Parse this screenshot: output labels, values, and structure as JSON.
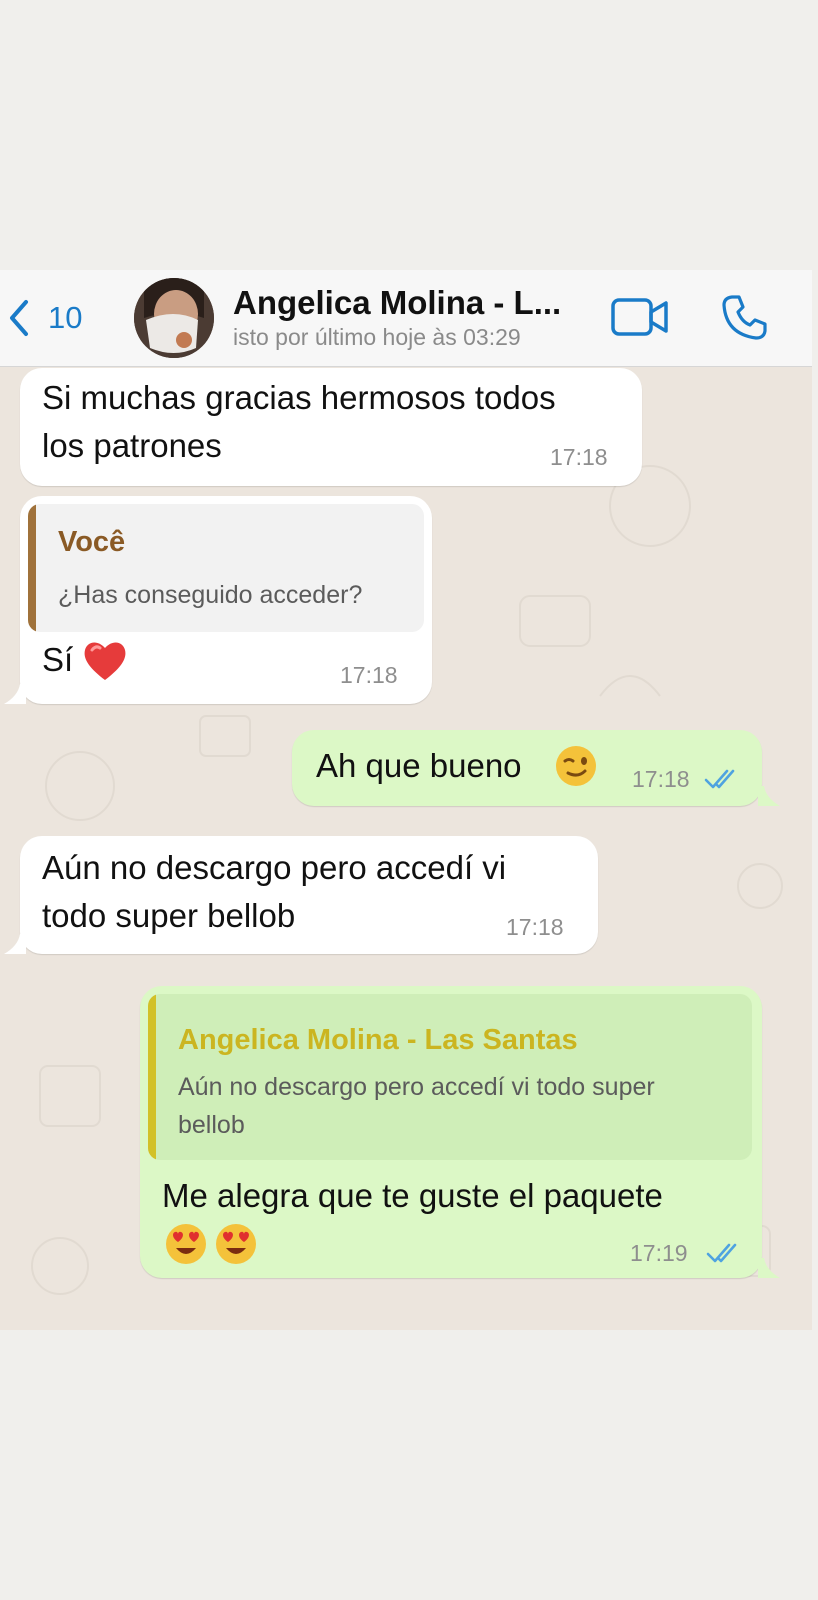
{
  "header": {
    "back_count": "10",
    "contact_name": "Angelica Molina - L...",
    "last_seen": "isto por último hoje às 03:29",
    "icons": {
      "back": "chevron-left-icon",
      "video": "video-camera-icon",
      "call": "phone-icon"
    },
    "accent": "#1a7bc8"
  },
  "messages": [
    {
      "direction": "in",
      "lines": [
        "Si muchas gracias hermosos todos",
        "los patrones"
      ],
      "time": "17:18"
    },
    {
      "direction": "in",
      "quote": {
        "author": "Você",
        "text": "¿Has conseguido acceder?",
        "bar_color": "#a0723b",
        "author_color": "#8a5a25"
      },
      "text": "Sí",
      "emoji": "heart-emoji",
      "time": "17:18"
    },
    {
      "direction": "out",
      "text": "Ah que bueno",
      "emoji": "winking-face-emoji",
      "time": "17:18",
      "status": "read"
    },
    {
      "direction": "in",
      "lines": [
        "Aún no descargo pero accedí vi",
        "todo super bellob"
      ],
      "time": "17:18"
    },
    {
      "direction": "out",
      "quote": {
        "author": "Angelica Molina - Las Santas",
        "lines": [
          "Aún no descargo pero accedí vi todo super",
          "bellob"
        ],
        "bar_color": "#d2c128",
        "author_color": "#cbb520"
      },
      "text": "Me alegra que te guste el paquete",
      "emoji": "heart-eyes-emoji",
      "time": "17:19",
      "status": "read"
    }
  ],
  "colors": {
    "incoming_bubble": "#ffffff",
    "outgoing_bubble": "#dcf8c6",
    "chat_background": "#ece5dd",
    "read_ticks": "#4fa3e0"
  }
}
